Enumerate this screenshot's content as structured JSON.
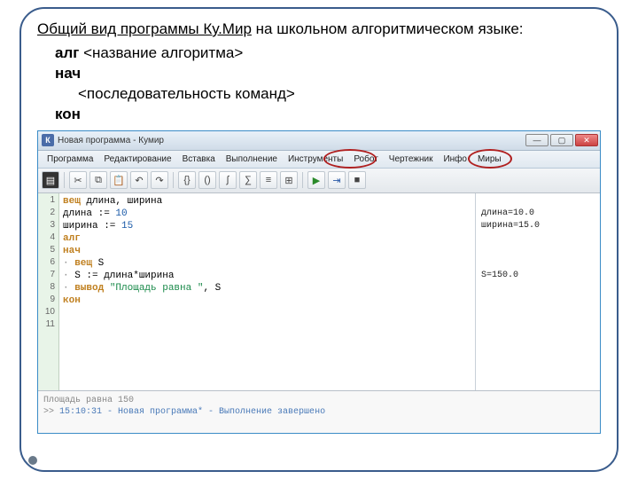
{
  "heading": {
    "underlined": "Общий вид программы Ку.Мир",
    "rest": " на школьном алгоритмическом языке:"
  },
  "template": {
    "l1_kw": "алг",
    "l1_rest": " <название алгоритма>",
    "l2_kw": "нач",
    "l3": "<последовательность команд>",
    "l4_kw": "кон"
  },
  "window": {
    "title": "Новая программа - Кумир",
    "icon_letter": "К",
    "min": "—",
    "max": "▢",
    "close": "✕"
  },
  "menus": [
    "Программа",
    "Редактирование",
    "Вставка",
    "Выполнение",
    "Инструменты",
    "Робот",
    "Чертежник",
    "Инфо",
    "Миры"
  ],
  "toolbar": {
    "save": "▤",
    "cut": "✂",
    "copy": "⧉",
    "paste": "📋",
    "undo": "↶",
    "redo": "↷",
    "run": "▶",
    "step": "⇥",
    "stop": "■",
    "b1": "{}",
    "b2": "()",
    "b3": "∫",
    "b4": "∑",
    "b5": "≡",
    "b6": "⊞"
  },
  "gutter": [
    "1",
    "2",
    "3",
    "4",
    "5",
    "6",
    "7",
    "8",
    "9",
    "10",
    "11"
  ],
  "code": {
    "l1": {
      "kw": "вещ",
      "rest": " длина, ширина"
    },
    "l2": {
      "a": "длина := ",
      "n": "10"
    },
    "l3": {
      "a": "ширина := ",
      "n": "15"
    },
    "l4": {
      "kw": "алг"
    },
    "l5": {
      "kw": "нач"
    },
    "l6": {
      "dot": "· ",
      "kw": "вещ",
      "rest": " S"
    },
    "l7": {
      "dot": "· ",
      "rest": "S := длина*ширина"
    },
    "l8": {
      "dot": "· ",
      "kw": "вывод",
      "str": " \"Площадь равна \"",
      "rest2": ", S"
    },
    "l9": {
      "kw": "кон"
    }
  },
  "side": {
    "s1": "длина=10.0",
    "s2": "ширина=15.0",
    "s3": "S=150.0"
  },
  "console": {
    "l1": "Площадь равна 150",
    "l2a": ">> ",
    "l2b": "15:10:31 - Новая программа* - Выполнение завершено"
  }
}
